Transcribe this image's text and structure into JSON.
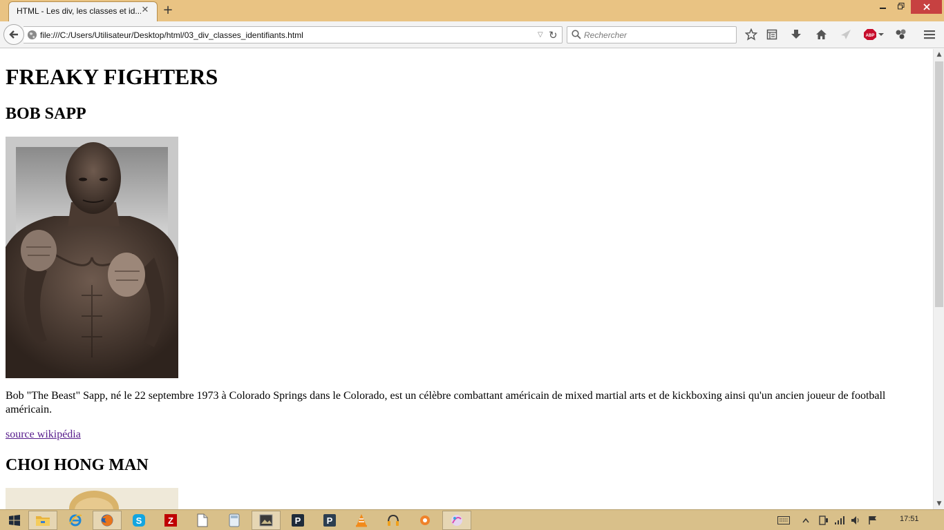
{
  "browser": {
    "tab_title": "HTML - Les div, les classes et id...",
    "tab_close_icon": "close-icon",
    "new_tab_label": "+",
    "url": "file:///C:/Users/Utilisateur/Desktop/html/03_div_classes_identifiants.html",
    "search_placeholder": "Rechercher",
    "toolbar_icons": [
      "bookmark-star-icon",
      "reading-list-icon",
      "download-icon",
      "home-icon",
      "send-icon",
      "adblock-plus-icon",
      "extension-icon",
      "menu-icon"
    ],
    "accent_color": "#e9c383",
    "close_color": "#c74141",
    "abp_badge": "ABP"
  },
  "page": {
    "title": "FREAKY FIGHTERS",
    "fighters": [
      {
        "name": "BOB SAPP",
        "description": "Bob \"The Beast\" Sapp, né le 22 septembre 1973 à Colorado Springs dans le Colorado, est un célèbre combattant américain de mixed martial arts et de kickboxing ainsi qu'un ancien joueur de football américain.",
        "source_link": "source wikipédia"
      },
      {
        "name": "CHOI HONG MAN"
      }
    ],
    "link_color": "#551a8b"
  },
  "taskbar": {
    "apps": [
      "windows-start-icon",
      "file-explorer-icon",
      "internet-explorer-icon",
      "firefox-icon",
      "skype-icon",
      "filezilla-icon",
      "notepad-icon",
      "calculator-icon",
      "photo-viewer-icon",
      "app-p-dark-icon",
      "app-p-icon",
      "vlc-icon",
      "headphones-app-icon",
      "media-app-icon",
      "paint-app-icon"
    ],
    "clock": "17:51",
    "color": "#d9c08a"
  }
}
